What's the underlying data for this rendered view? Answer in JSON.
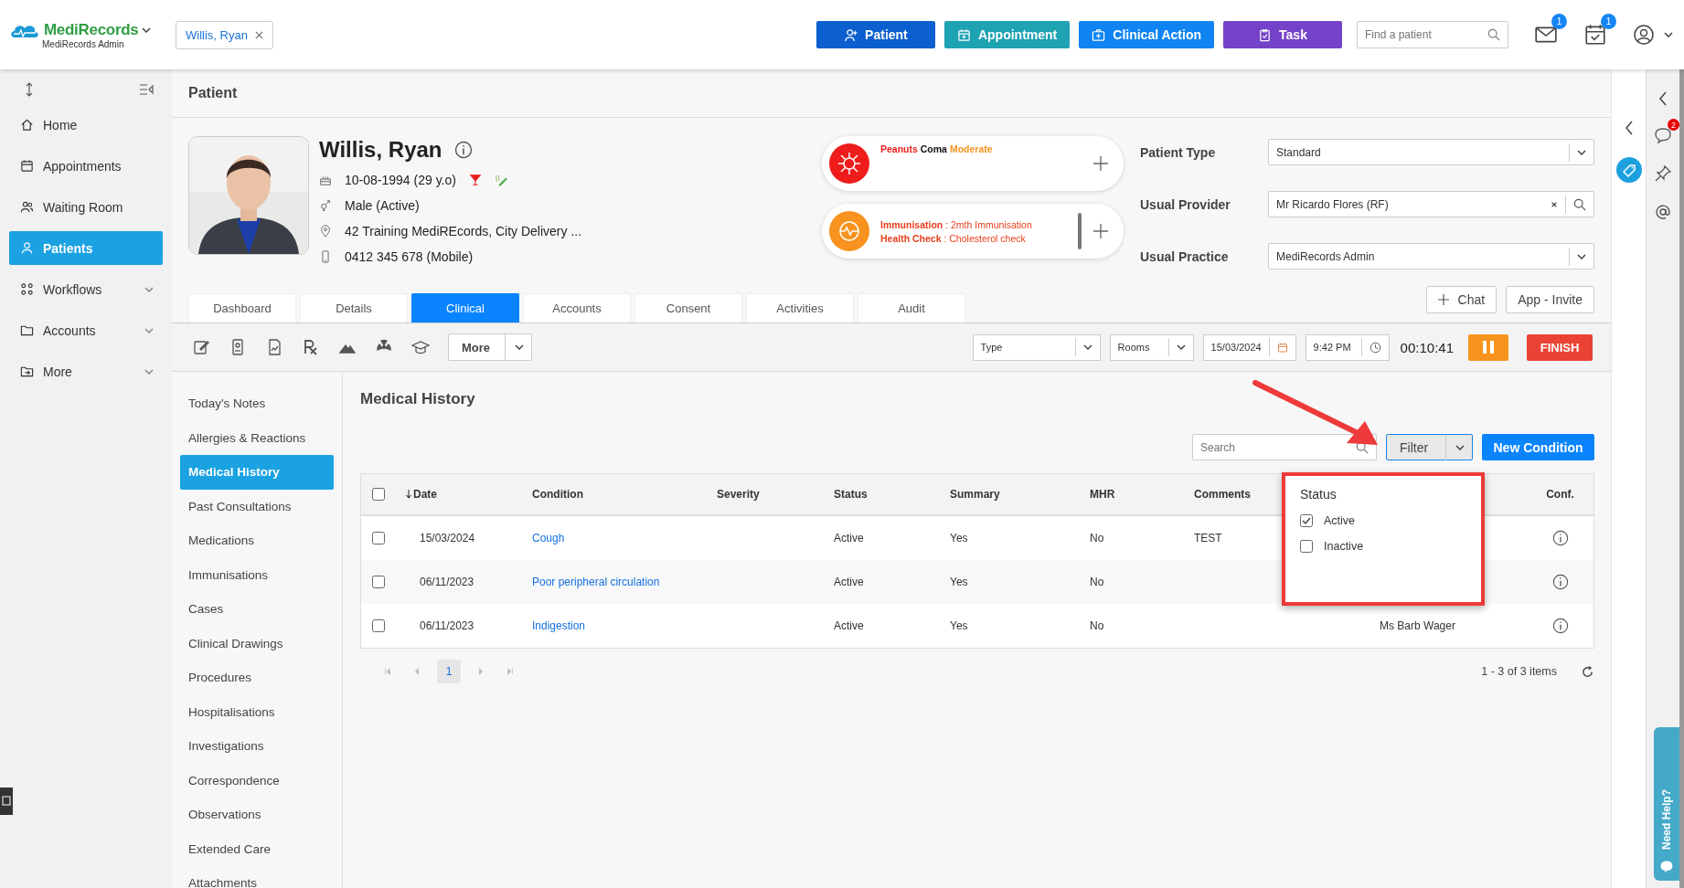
{
  "app": {
    "brand": "MediRecords",
    "subtitle": "MediRecords Admin"
  },
  "open_patient": "Willis, Ryan",
  "actions": [
    {
      "label": "Patient",
      "kind": "patient",
      "color": "#0b5fcf"
    },
    {
      "label": "Appointment",
      "kind": "appointment",
      "color": "#1ea3b3"
    },
    {
      "label": "Clinical Action",
      "kind": "clinical",
      "color": "#0f84f2"
    },
    {
      "label": "Task",
      "kind": "task",
      "color": "#7443c9"
    }
  ],
  "patient_search": {
    "placeholder": "Find a patient"
  },
  "notifications": [
    {
      "kind": "mail",
      "count": "1"
    },
    {
      "kind": "calendar",
      "count": "1"
    }
  ],
  "sidebar": {
    "items": [
      {
        "label": "Home",
        "kind": "home",
        "selected": false,
        "expandable": false
      },
      {
        "label": "Appointments",
        "kind": "calendar",
        "selected": false,
        "expandable": false
      },
      {
        "label": "Waiting Room",
        "kind": "people",
        "selected": false,
        "expandable": false
      },
      {
        "label": "Patients",
        "kind": "person",
        "selected": true,
        "expandable": false
      },
      {
        "label": "Workflows",
        "kind": "workflow",
        "selected": false,
        "expandable": true
      },
      {
        "label": "Accounts",
        "kind": "folder",
        "selected": false,
        "expandable": true
      },
      {
        "label": "More",
        "kind": "more",
        "selected": false,
        "expandable": true
      }
    ]
  },
  "page_title": "Patient",
  "patient": {
    "name": "Willis, Ryan",
    "details": [
      {
        "kind": "dob",
        "text": "10-08-1994 (29 y.o)"
      },
      {
        "kind": "gender",
        "text": "Male (Active)"
      },
      {
        "kind": "address",
        "text": "42 Training MediREcords, City Delivery ..."
      },
      {
        "kind": "phone",
        "text": "0412 345 678 (Mobile)"
      }
    ]
  },
  "alerts": [
    {
      "kind": "allergy",
      "segments": [
        {
          "text": "Peanuts",
          "color": "#e8201c"
        },
        {
          "text": "Coma",
          "color": "#111111"
        },
        {
          "text": "Moderate",
          "color": "#f7931e"
        }
      ]
    },
    {
      "kind": "reminder",
      "lines": [
        {
          "label": "Immunisation",
          "value": ": 2mth Immunisation"
        },
        {
          "label": "Health Check",
          "value": ": Cholesterol check"
        }
      ]
    }
  ],
  "fields": [
    {
      "label": "Patient Type",
      "value": "Standard",
      "kind": "select"
    },
    {
      "label": "Usual Provider",
      "value": "Mr Ricardo Flores (RF)",
      "kind": "lookup"
    },
    {
      "label": "Usual Practice",
      "value": "MediRecords Admin",
      "kind": "select"
    }
  ],
  "header_buttons": [
    {
      "label": "Chat",
      "kind": "chat"
    },
    {
      "label": "App - Invite",
      "kind": "plain"
    }
  ],
  "tabs": [
    {
      "label": "Dashboard",
      "selected": false
    },
    {
      "label": "Details",
      "selected": false
    },
    {
      "label": "Clinical",
      "selected": true
    },
    {
      "label": "Accounts",
      "selected": false
    },
    {
      "label": "Consent",
      "selected": false
    },
    {
      "label": "Activities",
      "selected": false
    },
    {
      "label": "Audit",
      "selected": false
    }
  ],
  "toolbar": {
    "more": "More",
    "type": "Type",
    "rooms": "Rooms",
    "date": "15/03/2024",
    "time": "9:42 PM",
    "timer": "00:10:41",
    "finish": "FINISH"
  },
  "clinical_nav": [
    {
      "label": "Today's Notes",
      "selected": false
    },
    {
      "label": "Allergies & Reactions",
      "selected": false
    },
    {
      "label": "Medical History",
      "selected": true
    },
    {
      "label": "Past Consultations",
      "selected": false
    },
    {
      "label": "Medications",
      "selected": false
    },
    {
      "label": "Immunisations",
      "selected": false
    },
    {
      "label": "Cases",
      "selected": false
    },
    {
      "label": "Clinical Drawings",
      "selected": false
    },
    {
      "label": "Procedures",
      "selected": false
    },
    {
      "label": "Hospitalisations",
      "selected": false
    },
    {
      "label": "Investigations",
      "selected": false
    },
    {
      "label": "Correspondence",
      "selected": false
    },
    {
      "label": "Observations",
      "selected": false
    },
    {
      "label": "Extended Care",
      "selected": false
    },
    {
      "label": "Attachments",
      "selected": false
    }
  ],
  "section_title": "Medical History",
  "table_search": {
    "placeholder": "Search"
  },
  "filter_button": "Filter",
  "new_button": "New Condition",
  "filter_menu": {
    "title": "Status",
    "options": [
      {
        "label": "Active",
        "checked": true
      },
      {
        "label": "Inactive",
        "checked": false
      }
    ]
  },
  "table": {
    "select_all_checked": false,
    "columns": [
      "Date",
      "Condition",
      "Severity",
      "Status",
      "Summary",
      "MHR",
      "Comments",
      "Conf."
    ],
    "rows": [
      {
        "checked": false,
        "date": "15/03/2024",
        "condition": "Cough",
        "status": "Active",
        "summary": "Yes",
        "mhr": "No",
        "comments": "TEST"
      },
      {
        "checked": false,
        "date": "06/11/2023",
        "condition": "Poor peripheral circulation",
        "status": "Active",
        "summary": "Yes",
        "mhr": "No"
      },
      {
        "checked": false,
        "date": "06/11/2023",
        "condition": "Indigestion",
        "status": "Active",
        "summary": "Yes",
        "mhr": "No",
        "column_8": "Ms Barb Wager"
      }
    ]
  },
  "pagination": {
    "pages": [
      {
        "label": "1",
        "selected": true
      }
    ],
    "summary": "1 - 3 of 3 items"
  },
  "rail": {
    "chat_count": "2"
  },
  "help": "Need Help?"
}
